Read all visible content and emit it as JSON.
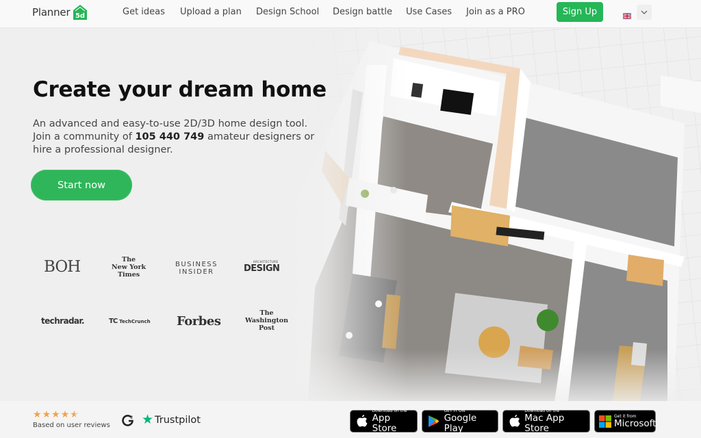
{
  "brand": {
    "name": "Planner",
    "badge": "5d",
    "accent_color": "#25b657"
  },
  "nav": {
    "links": [
      {
        "label": "Get ideas"
      },
      {
        "label": "Upload a plan"
      },
      {
        "label": "Design School"
      },
      {
        "label": "Design battle"
      },
      {
        "label": "Use Cases"
      },
      {
        "label": "Join as a PRO"
      }
    ],
    "signup_label": "Sign Up",
    "language_icon": "uk-flag-icon",
    "language_dropdown_icon": "chevron-down-icon"
  },
  "hero": {
    "title": "Create your dream home",
    "desc_line1": "An advanced and easy-to-use 2D/3D home design tool.",
    "desc_prefix": "Join a community of ",
    "community_count": "105 440 749",
    "desc_suffix": " amateur designers or hire a professional designer.",
    "cta_label": "Start now",
    "image_alt": "3D isometric floor plan of an apartment"
  },
  "press": {
    "boh": "BOH",
    "nyt": [
      "The",
      "New York",
      "Times"
    ],
    "business_insider": [
      "BUSINESS",
      "INSIDER"
    ],
    "architecture_design_small": "ARCHITECTURE",
    "architecture_design": "DESIGN",
    "techradar": "techradar.",
    "techcrunch_mark": "TC",
    "techcrunch": "TechCrunch",
    "forbes": "Forbes",
    "wapo": [
      "The",
      "Washington",
      "Post"
    ]
  },
  "footer": {
    "rating_stars": 4.5,
    "rating_max": 5,
    "reviews_label": "Based on user reviews",
    "g2_label": "G2",
    "trustpilot_label": "Trustpilot",
    "stores": [
      {
        "small": "Download on the",
        "big": "App Store",
        "icon": "apple-icon"
      },
      {
        "small": "GET IT ON",
        "big": "Google Play",
        "icon": "google-play-icon"
      },
      {
        "small": "Download on the",
        "big": "Mac App Store",
        "icon": "apple-icon"
      },
      {
        "small": "Get it from",
        "big": "Microsoft",
        "icon": "microsoft-icon"
      }
    ]
  }
}
